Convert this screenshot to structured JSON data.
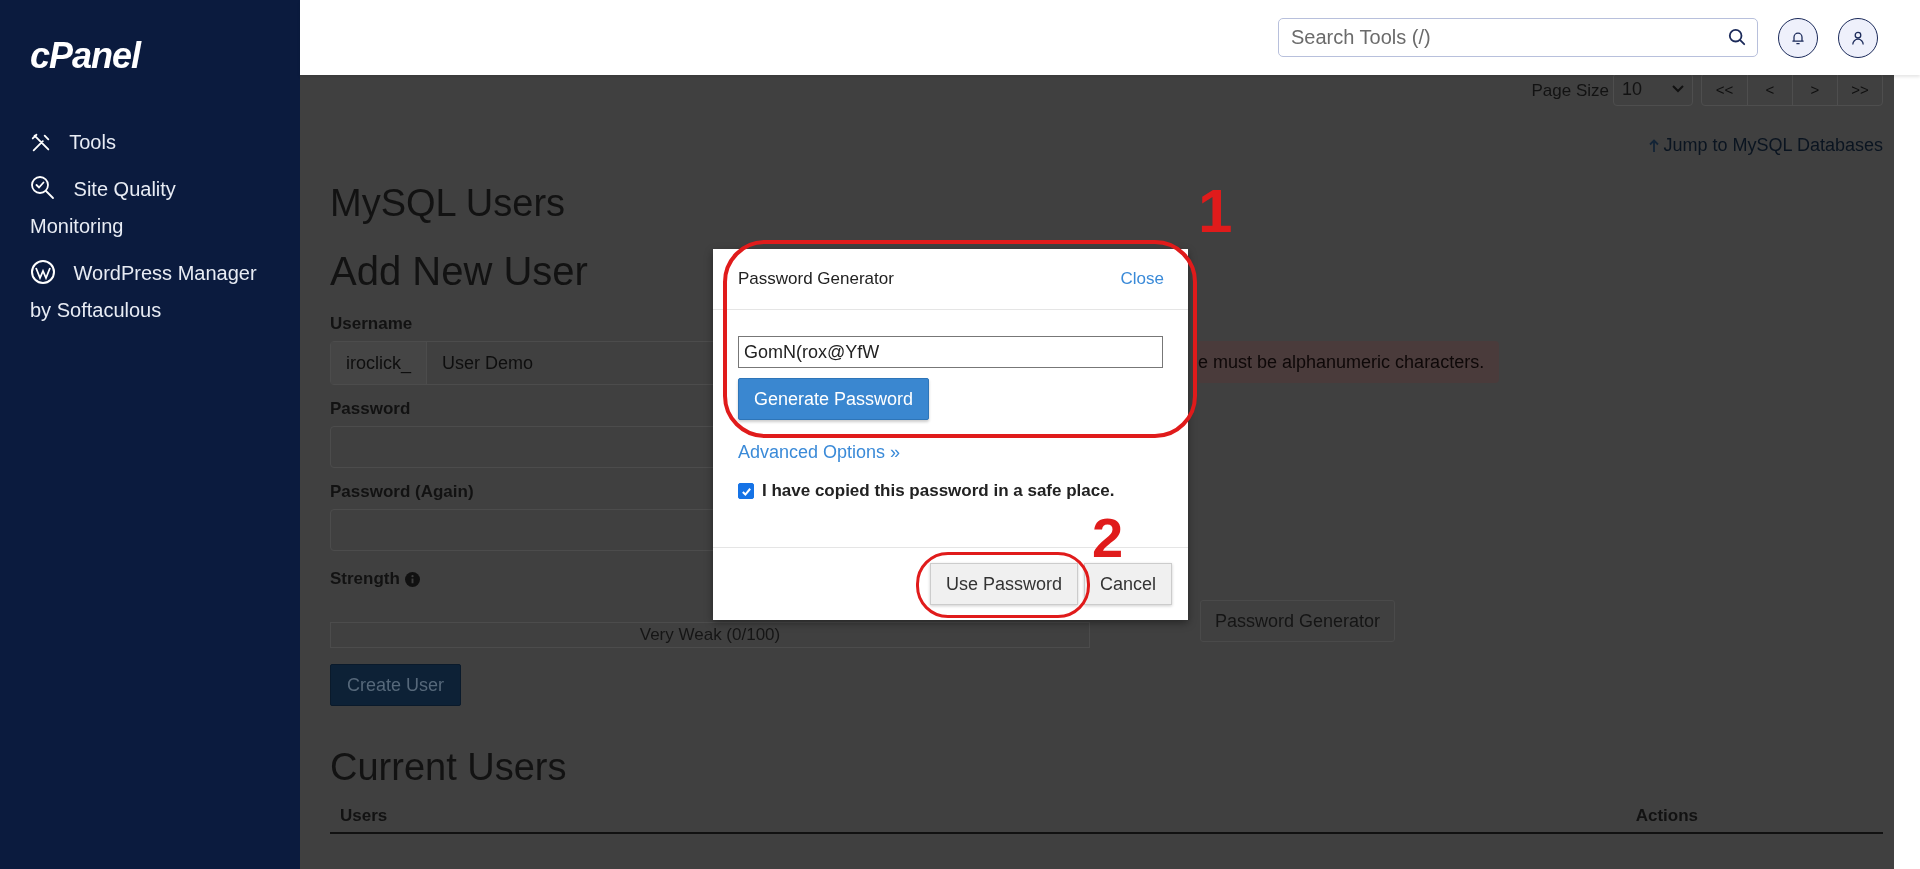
{
  "sidebar": {
    "logo": "cPanel",
    "items": [
      {
        "label": "Tools"
      },
      {
        "label": "Site Quality Monitoring"
      },
      {
        "label": "WordPress Manager by Softaculous"
      }
    ]
  },
  "header": {
    "search": {
      "placeholder": "Search Tools (/)"
    }
  },
  "pagination": {
    "label": "Page Size",
    "page_size": "10",
    "buttons": [
      "<<",
      "<",
      ">",
      ">>"
    ]
  },
  "jump_link": "Jump to MySQL Databases",
  "page_title": "MySQL Users",
  "add_user": {
    "heading": "Add New User",
    "username": {
      "label": "Username",
      "prefix": "iroclick_",
      "value": "User Demo"
    },
    "password": {
      "label": "Password"
    },
    "password_again": {
      "label": "Password (Again)"
    },
    "strength": {
      "label": "Strength",
      "level": 0,
      "reading": "Very Weak (0/100)"
    },
    "alert": "e must be alphanumeric characters.",
    "generator_button": "Password Generator",
    "submit": "Create User"
  },
  "current_users": {
    "heading": "Current Users",
    "columns": [
      "Users",
      "Actions"
    ]
  },
  "modal": {
    "title": "Password Generator",
    "close": "Close",
    "password": "GomN(rox@YfW",
    "generate": "Generate Password",
    "advanced": "Advanced Options »",
    "confirm": {
      "label": "I have copied this password in a safe place.",
      "checked": true
    },
    "buttons": [
      {
        "label": "Use Password"
      },
      {
        "label": "Cancel"
      }
    ]
  },
  "annotations": [
    {
      "number": "1"
    },
    {
      "number": "2"
    }
  ]
}
